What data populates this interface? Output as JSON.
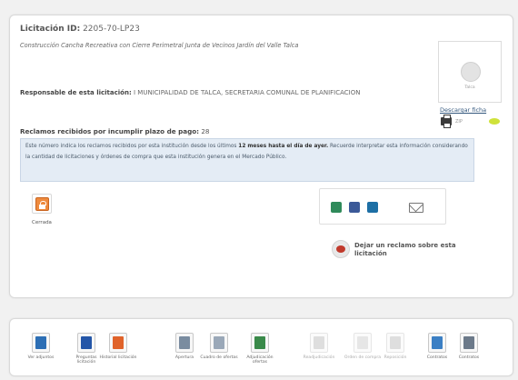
{
  "header": {
    "label": "Licitación ID:",
    "id": "2205-70-LP23"
  },
  "description": "Construcción Cancha Recreativa con Cierre Perimetral Junta de Vecinos Jardín del Valle Talca",
  "responsible": {
    "label": "Responsable de esta licitación:",
    "value": "I MUNICIPALIDAD DE TALCA, SECRETARIA COMUNAL DE PLANIFICACION"
  },
  "claims": {
    "label": "Reclamos recibidos por incumplir plazo de pago:",
    "count": "28",
    "info_pre": "Este número indica los reclamos recibidos por esta institución desde los últimos",
    "info_bold": "12 meses hasta el día de ayer.",
    "info_post": "Recuerde interpretar esta información considerando la cantidad de licitaciones y órdenes de compra que esta institución genera en el Mercado Público."
  },
  "thumbnail": {
    "caption": "Talca"
  },
  "download": {
    "label": "Descargar ficha",
    "meta": "ZIP"
  },
  "status": {
    "label": "Cerrada",
    "color": "#ee8a3d"
  },
  "share": {
    "buttons": [
      "share-green-icon",
      "facebook-icon",
      "twitter-icon",
      "mail-icon"
    ]
  },
  "claim_link": {
    "label": "Dejar un reclamo sobre esta licitación"
  },
  "toolbar": {
    "items": [
      {
        "label": "Ver adjuntos",
        "icon": "attachments-icon",
        "color": "#2d6fb5",
        "enabled": true
      },
      {
        "label": "Preguntas licitación",
        "icon": "question-icon",
        "color": "#2456a8",
        "enabled": true
      },
      {
        "label": "Historial licitación",
        "icon": "history-icon",
        "color": "#e0632a",
        "enabled": true
      },
      {
        "label": "Apertura",
        "icon": "envelope-open-icon",
        "color": "#7a8ca0",
        "enabled": true
      },
      {
        "label": "Cuadro de ofertas",
        "icon": "offers-grid-icon",
        "color": "#9aa8b8",
        "enabled": true
      },
      {
        "label": "Adjudicación ofertas",
        "icon": "adjudication-icon",
        "color": "#3a8a4a",
        "enabled": true
      },
      {
        "label": "Readjudicación",
        "icon": "readjudication-icon",
        "color": "#b8b8b8",
        "enabled": false
      },
      {
        "label": "Orden de compra",
        "icon": "purchase-order-icon",
        "color": "#c8c8c8",
        "enabled": false
      },
      {
        "label": "Reposición",
        "icon": "reposition-icon",
        "color": "#b8b8b8",
        "enabled": false
      },
      {
        "label": "Contratos",
        "icon": "contracts-icon",
        "color": "#3b7fc4",
        "enabled": true
      },
      {
        "label": "Contratos",
        "icon": "contracts-print-icon",
        "color": "#6c7a8a",
        "enabled": true
      }
    ]
  }
}
